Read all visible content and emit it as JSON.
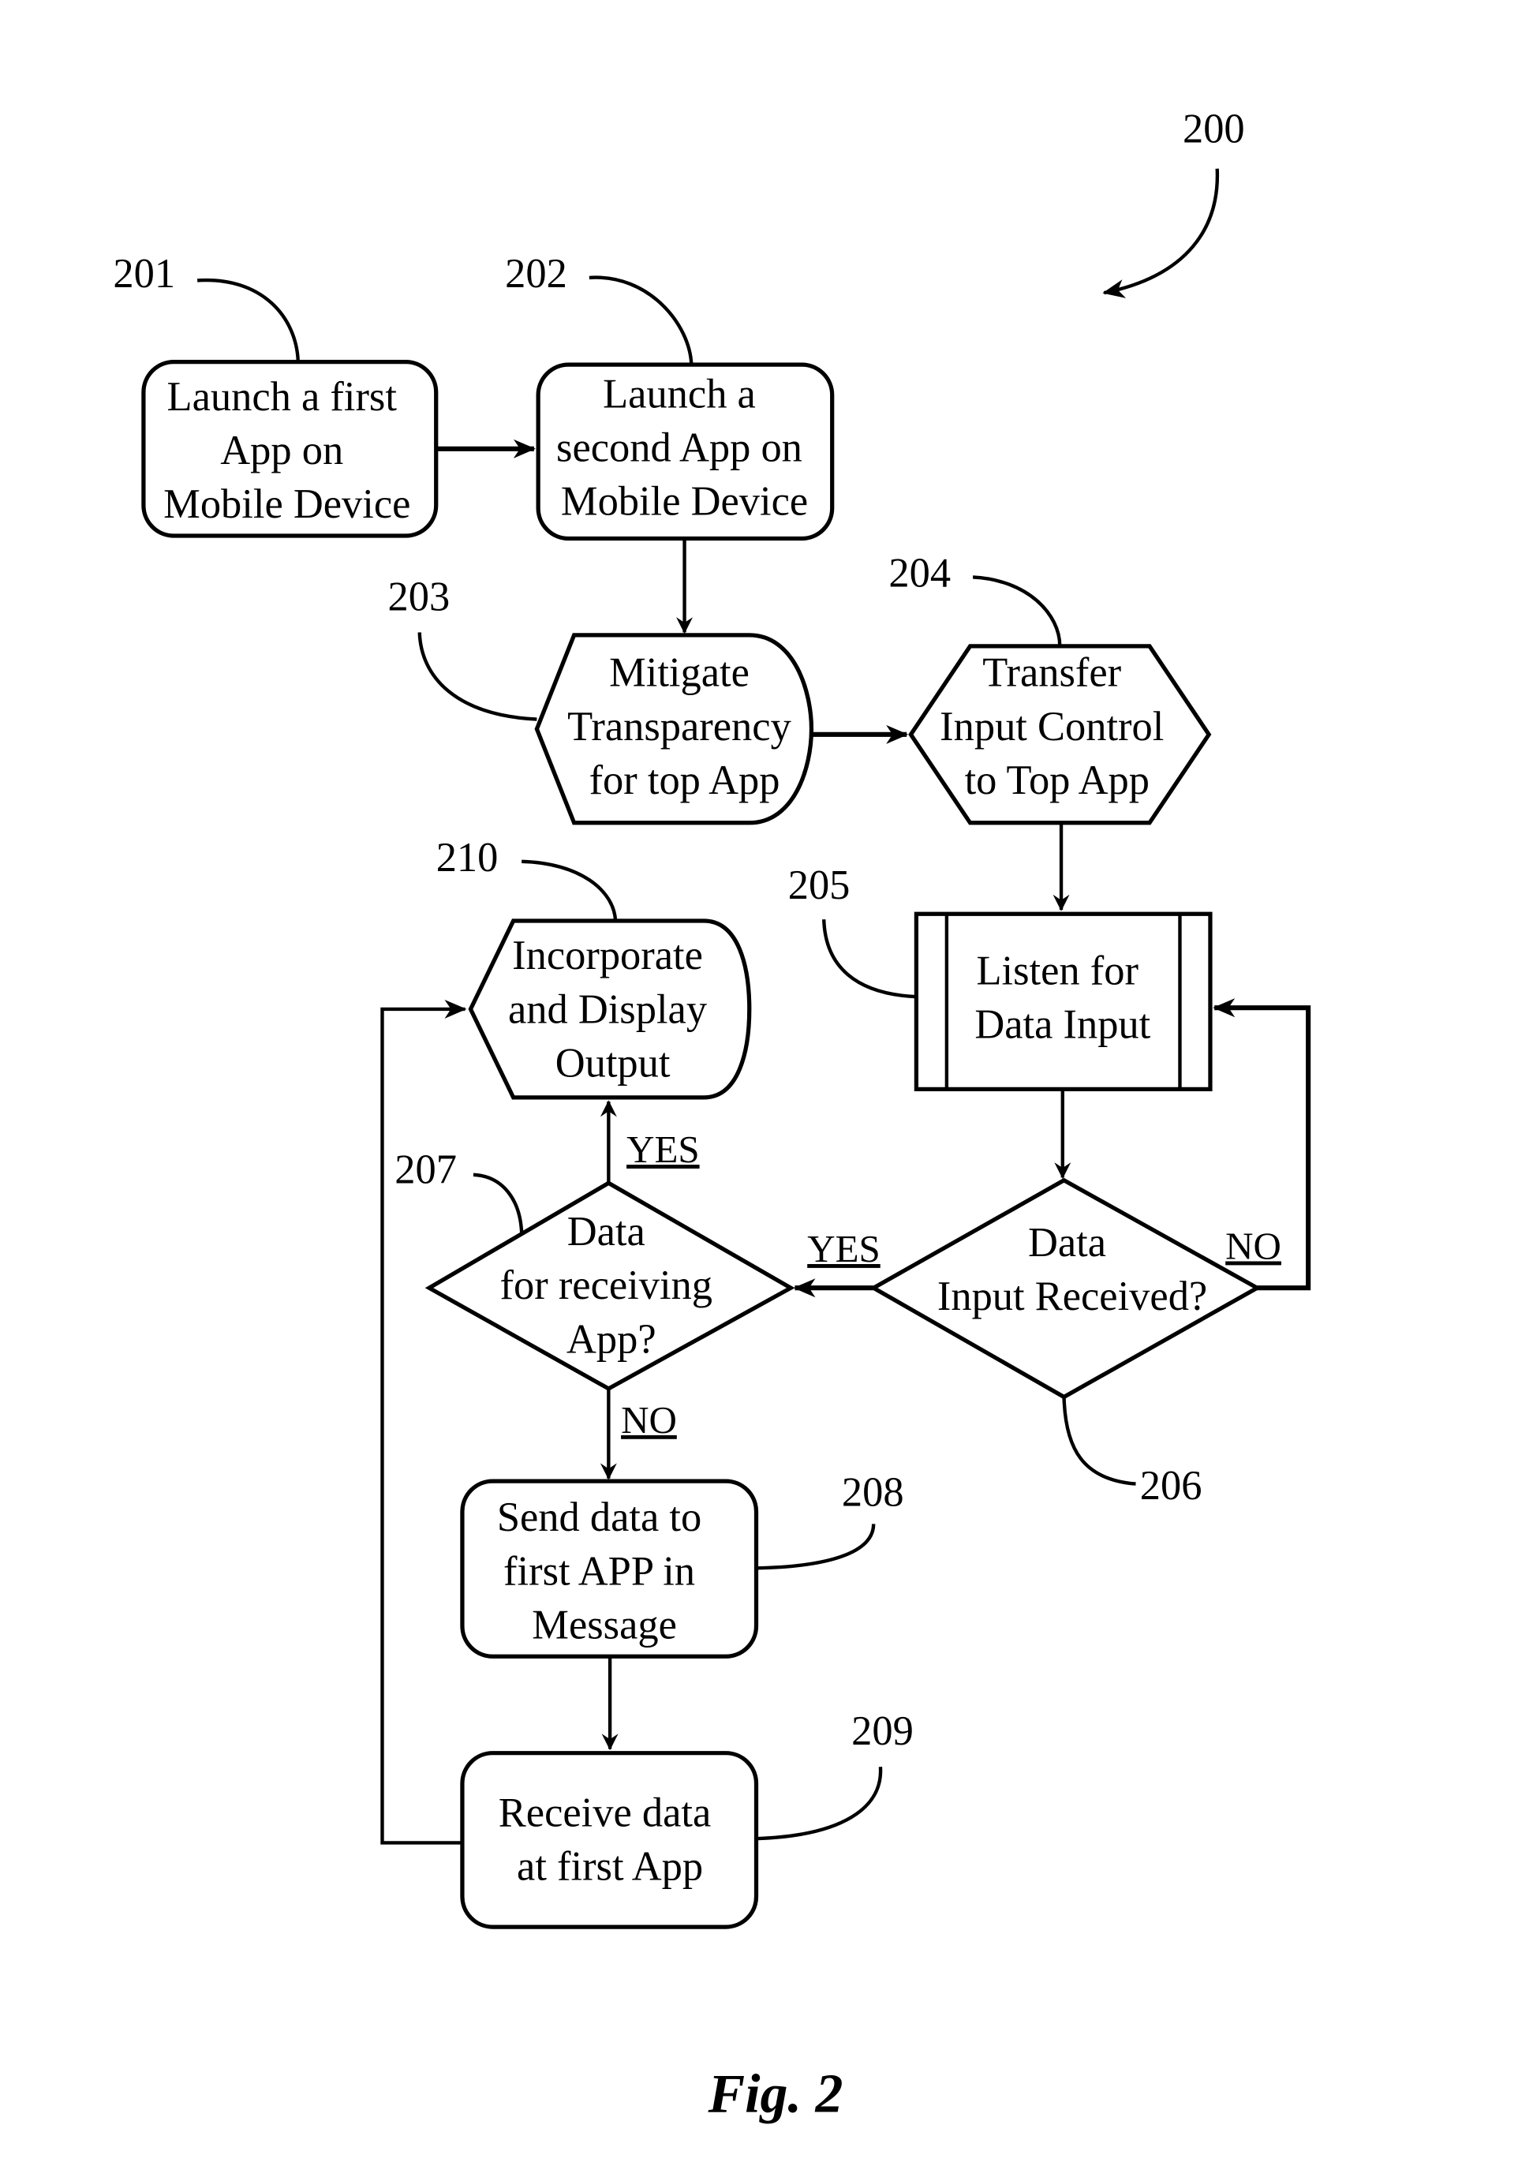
{
  "figure": {
    "number": "200",
    "caption": "Fig. 2"
  },
  "nodes": {
    "n201": {
      "ref": "201",
      "lines": [
        "Launch a first",
        "App on",
        "Mobile Device"
      ]
    },
    "n202": {
      "ref": "202",
      "lines": [
        "Launch a",
        "second App on",
        "Mobile Device"
      ]
    },
    "n203": {
      "ref": "203",
      "lines": [
        "Mitigate",
        "Transparency",
        "for top App"
      ]
    },
    "n204": {
      "ref": "204",
      "lines": [
        "Transfer",
        "Input Control",
        "to Top App"
      ]
    },
    "n205": {
      "ref": "205",
      "lines": [
        "Listen for",
        "Data Input"
      ]
    },
    "n206": {
      "ref": "206",
      "lines": [
        "Data",
        "Input Received?"
      ]
    },
    "n207": {
      "ref": "207",
      "lines": [
        "Data",
        "for receiving",
        "App?"
      ]
    },
    "n208": {
      "ref": "208",
      "lines": [
        "Send data to",
        "first APP in",
        "Message"
      ]
    },
    "n209": {
      "ref": "209",
      "lines": [
        "Receive data",
        "at first App"
      ]
    },
    "n210": {
      "ref": "210",
      "lines": [
        "Incorporate",
        "and Display",
        "Output"
      ]
    }
  },
  "edge_labels": {
    "e206_yes": "YES",
    "e206_no": "NO",
    "e207_yes": "YES",
    "e207_no": "NO"
  }
}
